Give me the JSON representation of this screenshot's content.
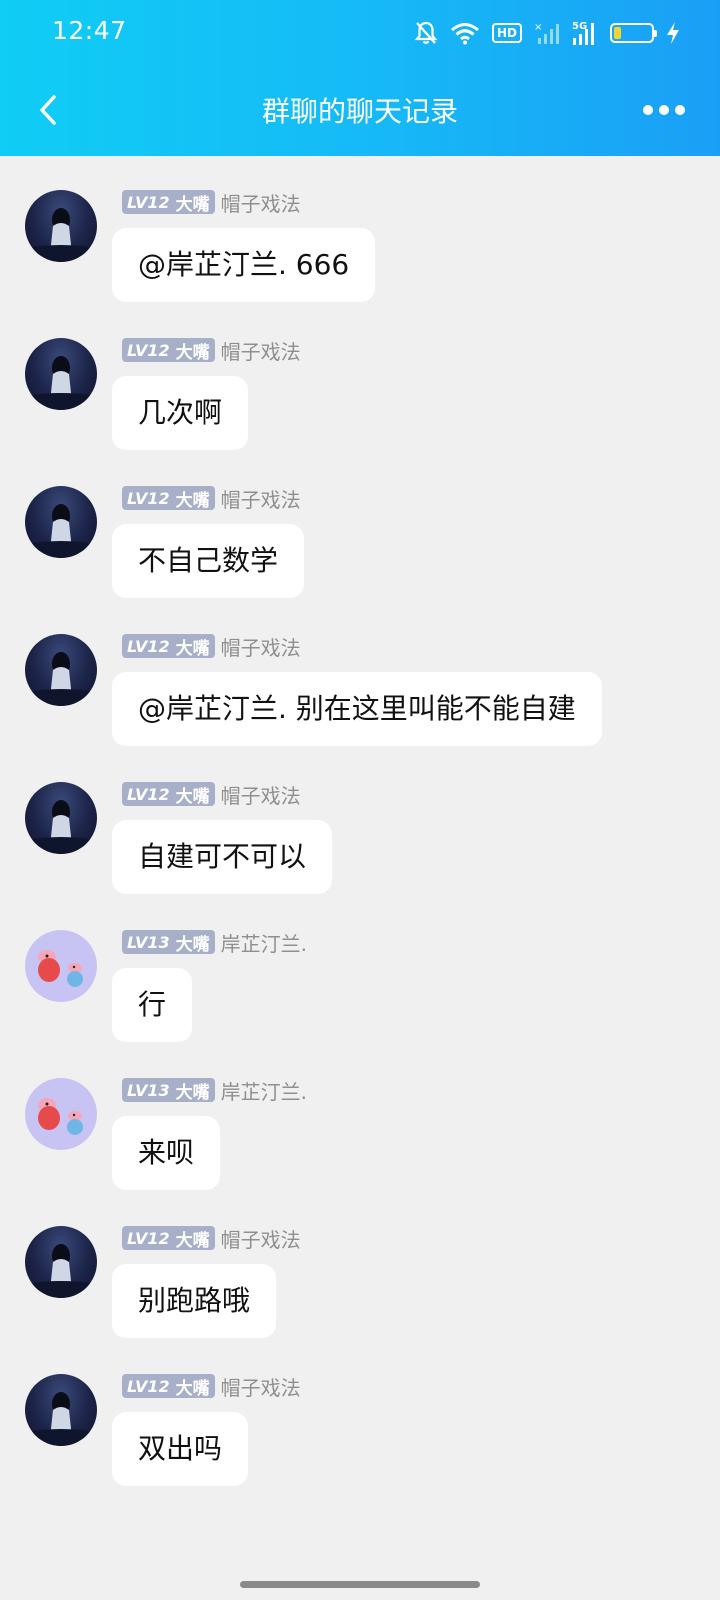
{
  "status_bar": {
    "time": "12:47",
    "network": "5G",
    "hd_badge": "HD",
    "battery_level": 0.2,
    "icons": [
      "mute-bell-icon",
      "wifi-icon",
      "hd-icon",
      "signal-off-icon",
      "signal-5g-icon",
      "battery-icon",
      "charging-bolt-icon"
    ]
  },
  "nav": {
    "title": "群聊的聊天记录",
    "back_icon": "chevron-left-icon",
    "more_icon": "more-dots-icon"
  },
  "colors": {
    "header_start": "#10cdf5",
    "header_end": "#1a9ff6",
    "background": "#f0f0f0",
    "bubble": "#ffffff",
    "level_badge": "#a7b0c8",
    "sender_text": "#8f8f8f"
  },
  "messages": [
    {
      "level": "LV12",
      "title": "大嘴",
      "sender": "帽子戏法",
      "text": "@岸芷汀兰. 666",
      "avatar": "dark-girl-avatar"
    },
    {
      "level": "LV12",
      "title": "大嘴",
      "sender": "帽子戏法",
      "text": "几次啊",
      "avatar": "dark-girl-avatar"
    },
    {
      "level": "LV12",
      "title": "大嘴",
      "sender": "帽子戏法",
      "text": "不自己数学",
      "avatar": "dark-girl-avatar"
    },
    {
      "level": "LV12",
      "title": "大嘴",
      "sender": "帽子戏法",
      "text": "@岸芷汀兰. 别在这里叫能不能自建",
      "avatar": "dark-girl-avatar"
    },
    {
      "level": "LV12",
      "title": "大嘴",
      "sender": "帽子戏法",
      "text": "自建可不可以",
      "avatar": "dark-girl-avatar"
    },
    {
      "level": "LV13",
      "title": "大嘴",
      "sender": "岸芷汀兰.",
      "text": "行",
      "avatar": "peppa-pig-avatar"
    },
    {
      "level": "LV13",
      "title": "大嘴",
      "sender": "岸芷汀兰.",
      "text": "来呗",
      "avatar": "peppa-pig-avatar"
    },
    {
      "level": "LV12",
      "title": "大嘴",
      "sender": "帽子戏法",
      "text": "别跑路哦",
      "avatar": "dark-girl-avatar"
    },
    {
      "level": "LV12",
      "title": "大嘴",
      "sender": "帽子戏法",
      "text": "双出吗",
      "avatar": "dark-girl-avatar"
    }
  ]
}
